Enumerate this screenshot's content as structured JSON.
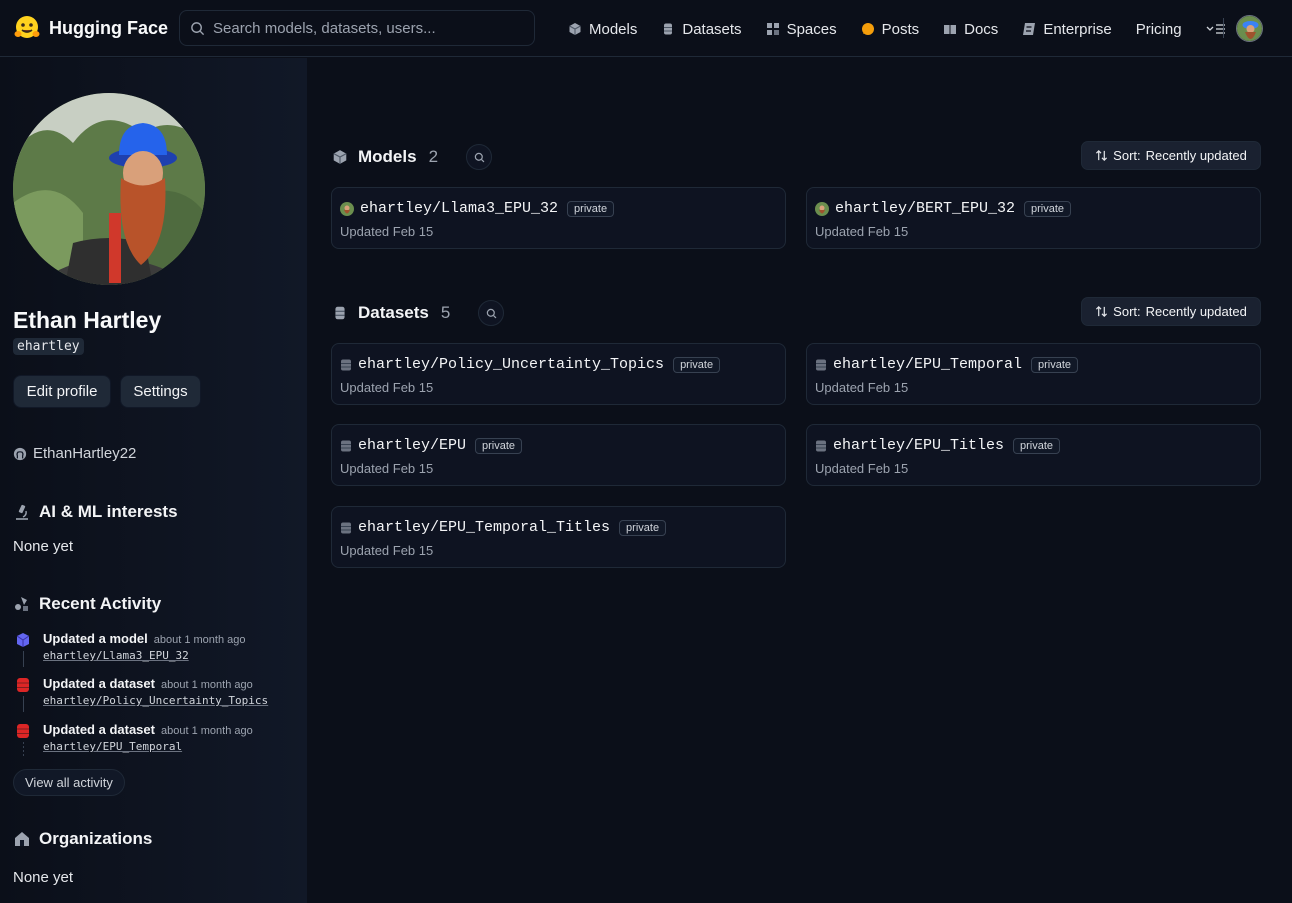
{
  "header": {
    "brand": "Hugging Face",
    "search_placeholder": "Search models, datasets, users...",
    "nav": [
      {
        "label": "Models",
        "icon": "cube-icon"
      },
      {
        "label": "Datasets",
        "icon": "database-icon"
      },
      {
        "label": "Spaces",
        "icon": "grid-icon"
      },
      {
        "label": "Posts",
        "icon": "speech-bubble-icon"
      },
      {
        "label": "Docs",
        "icon": "book-icon"
      },
      {
        "label": "Enterprise",
        "icon": "enterprise-icon"
      },
      {
        "label": "Pricing",
        "icon": ""
      }
    ]
  },
  "profile": {
    "fullname": "Ethan Hartley",
    "username": "ehartley",
    "edit_label": "Edit profile",
    "settings_label": "Settings",
    "github": "EthanHartley22",
    "interests_title": "AI & ML interests",
    "interests_value": "None yet",
    "activity_title": "Recent Activity",
    "activity": [
      {
        "title": "Updated a model",
        "time": "about 1 month ago",
        "link": "ehartley/Llama3_EPU_32",
        "kind": "model"
      },
      {
        "title": "Updated a dataset",
        "time": "about 1 month ago",
        "link": "ehartley/Policy_Uncertainty_Topics",
        "kind": "dataset"
      },
      {
        "title": "Updated a dataset",
        "time": "about 1 month ago",
        "link": "ehartley/EPU_Temporal",
        "kind": "dataset"
      }
    ],
    "view_all": "View all activity",
    "orgs_title": "Organizations",
    "orgs_value": "None yet"
  },
  "models": {
    "title": "Models",
    "count": "2",
    "sort_prefix": "Sort:",
    "sort_value": "Recently updated",
    "items": [
      {
        "name": "ehartley/Llama3_EPU_32",
        "badge": "private",
        "updated": "Updated Feb 15"
      },
      {
        "name": "ehartley/BERT_EPU_32",
        "badge": "private",
        "updated": "Updated Feb 15"
      }
    ]
  },
  "datasets": {
    "title": "Datasets",
    "count": "5",
    "sort_prefix": "Sort:",
    "sort_value": "Recently updated",
    "items": [
      {
        "name": "ehartley/Policy_Uncertainty_Topics",
        "badge": "private",
        "updated": "Updated Feb 15"
      },
      {
        "name": "ehartley/EPU_Temporal",
        "badge": "private",
        "updated": "Updated Feb 15"
      },
      {
        "name": "ehartley/EPU",
        "badge": "private",
        "updated": "Updated Feb 15"
      },
      {
        "name": "ehartley/EPU_Titles",
        "badge": "private",
        "updated": "Updated Feb 15"
      },
      {
        "name": "ehartley/EPU_Temporal_Titles",
        "badge": "private",
        "updated": "Updated Feb 15"
      }
    ]
  },
  "colors": {
    "background": "#0b0f19",
    "accent_model": "#6366f1",
    "accent_dataset": "#dc2626",
    "posts": "#f59e0b"
  }
}
